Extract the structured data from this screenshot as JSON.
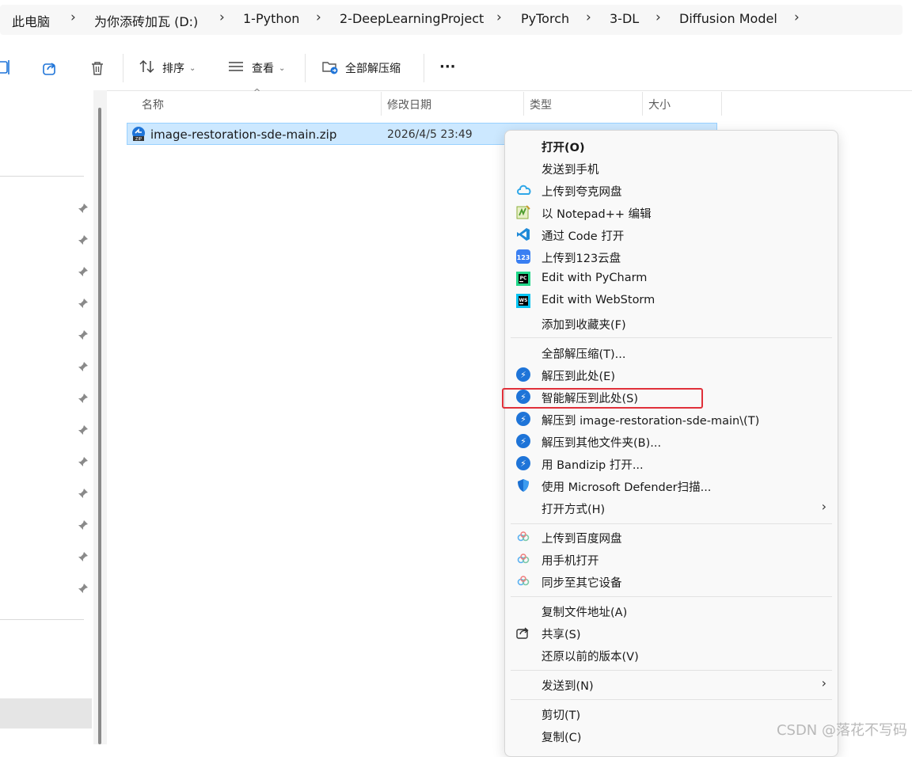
{
  "breadcrumb": {
    "items": [
      "此电脑",
      "为你添砖加瓦 (D:)",
      "1-Python",
      "2-DeepLearningProject",
      "PyTorch",
      "3-DL",
      "Diffusion Model"
    ],
    "separator": "›"
  },
  "toolbar": {
    "sort_label": "排序",
    "view_label": "查看",
    "extract_all_label": "全部解压缩",
    "more_label": "···"
  },
  "columns": {
    "name": "名称",
    "modified": "修改日期",
    "type": "类型",
    "size": "大小"
  },
  "file": {
    "name": "image-restoration-sde-main.zip",
    "modified": "2026/4/5 23:49"
  },
  "context_menu": {
    "open": "打开(O)",
    "send_to_phone": "发送到手机",
    "upload_quark": "上传到夸克网盘",
    "notepad": "以 Notepad++ 编辑",
    "vscode": "通过 Code 打开",
    "upload_123": "上传到123云盘",
    "pycharm": "Edit with PyCharm",
    "webstorm": "Edit with WebStorm",
    "add_favorites": "添加到收藏夹(F)",
    "extract_all": "全部解压缩(T)...",
    "extract_here": "解压到此处(E)",
    "smart_extract": "智能解压到此处(S)",
    "extract_to_folder": "解压到 image-restoration-sde-main\\(T)",
    "extract_other": "解压到其他文件夹(B)...",
    "open_bandizip": "用 Bandizip 打开...",
    "defender": "使用 Microsoft Defender扫描...",
    "open_with": "打开方式(H)",
    "upload_baidu": "上传到百度网盘",
    "open_phone": "用手机打开",
    "sync_devices": "同步至其它设备",
    "copy_path": "复制文件地址(A)",
    "share": "共享(S)",
    "restore_versions": "还原以前的版本(V)",
    "send_to": "发送到(N)",
    "cut": "剪切(T)",
    "copy": "复制(C)"
  },
  "watermark": "CSDN @落花不写码",
  "colors": {
    "selection_bg": "#cce8ff",
    "highlight_border": "#e0303a",
    "bandizip_blue": "#1e74d8"
  }
}
